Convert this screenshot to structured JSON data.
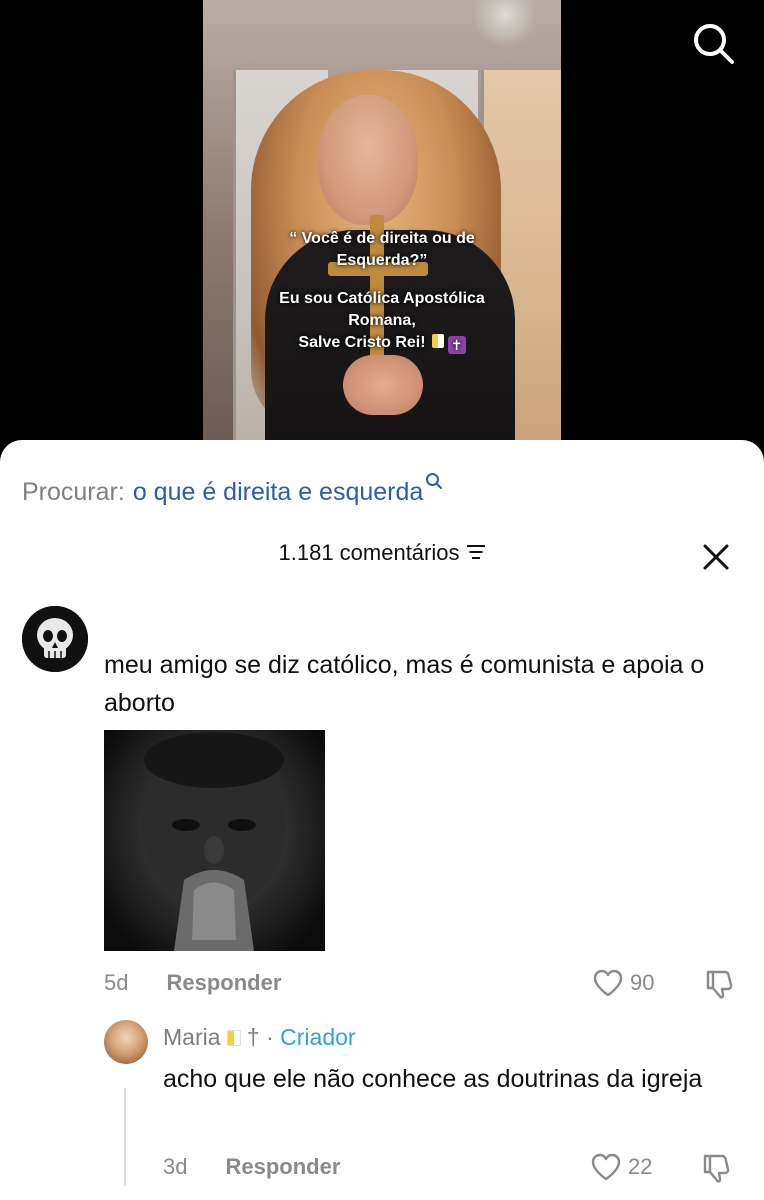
{
  "video": {
    "overlay_lines": [
      "“ Você é de direita ou de",
      "Esquerda?”",
      "",
      "Eu sou Católica Apostólica",
      "Romana,",
      "Salve Cristo Rei!"
    ]
  },
  "search_suggestion": {
    "label": "Procurar:",
    "query": "o que é direita e esquerda"
  },
  "comments_header": {
    "count_text": "1.181 comentários"
  },
  "comments": [
    {
      "text": "meu amigo se diz católico, mas é comunista e apoia o aborto",
      "age": "5d",
      "reply_label": "Responder",
      "likes": "90",
      "replies": [
        {
          "author": "Maria",
          "author_symbol": "†",
          "separator": "·",
          "creator_label": "Criador",
          "text": "acho que ele não conhece as doutrinas da igreja",
          "age": "3d",
          "reply_label": "Responder",
          "likes": "22"
        }
      ]
    }
  ],
  "icons": {
    "search": "search-icon",
    "filter": "filter-lines-icon",
    "close": "close-icon",
    "like": "heart-icon",
    "dislike": "thumbs-down-icon"
  },
  "colors": {
    "search_query": "#2a5db0",
    "creator": "#2fa4cf",
    "muted": "#8a8a8a"
  }
}
